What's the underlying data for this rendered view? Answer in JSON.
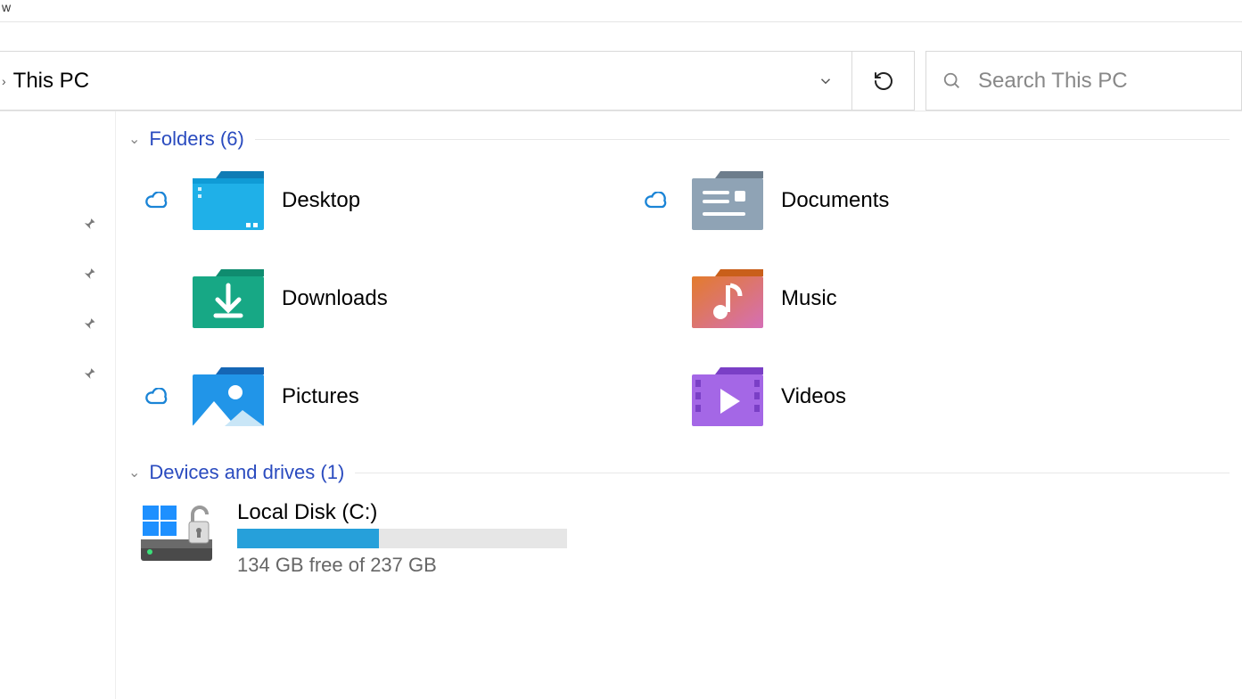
{
  "titlebar": {
    "fragment": "w"
  },
  "breadcrumb": {
    "location": "This PC"
  },
  "search": {
    "placeholder": "Search This PC"
  },
  "sections": {
    "folders": {
      "label": "Folders (6)",
      "items": [
        {
          "name": "Desktop",
          "cloud": true
        },
        {
          "name": "Documents",
          "cloud": true
        },
        {
          "name": "Downloads",
          "cloud": false
        },
        {
          "name": "Music",
          "cloud": false
        },
        {
          "name": "Pictures",
          "cloud": true
        },
        {
          "name": "Videos",
          "cloud": false
        }
      ]
    },
    "drives": {
      "label": "Devices and drives (1)",
      "items": [
        {
          "name": "Local Disk (C:)",
          "free_text": "134 GB free of 237 GB",
          "used_gb": 103,
          "total_gb": 237,
          "fill_percent": 43
        }
      ]
    }
  }
}
